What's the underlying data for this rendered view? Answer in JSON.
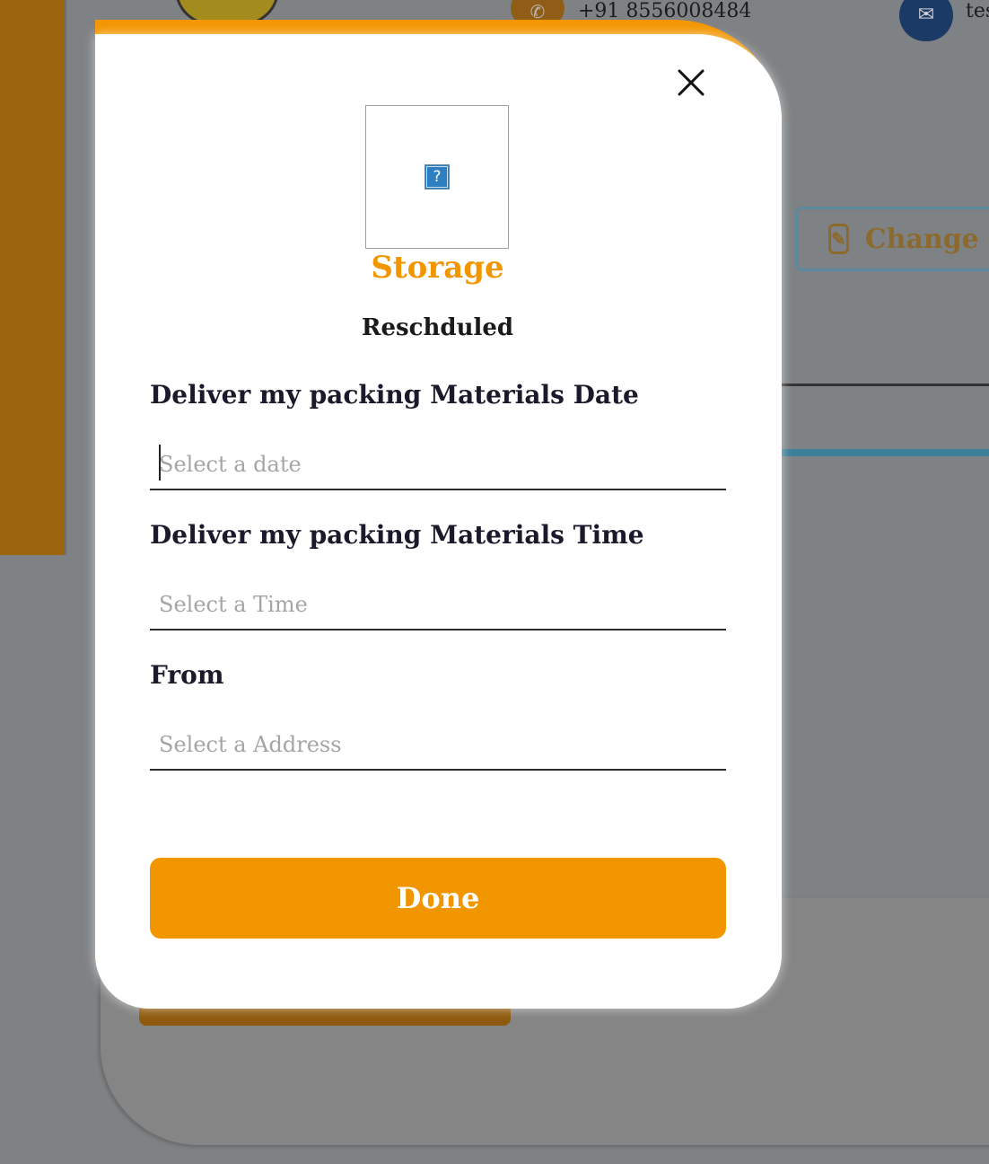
{
  "background": {
    "phone_number": "+91 8556008484",
    "email_text": "tes",
    "change_button_label": "Change Pa",
    "phone_icon": "phone-icon",
    "mail_icon": "mail-icon",
    "pencil_icon": "pencil-icon"
  },
  "modal": {
    "close_icon": "close-icon",
    "image_icon": "broken-image-icon",
    "broken_image_glyph": "?",
    "title": "Storage",
    "subtitle": "Reschduled",
    "fields": [
      {
        "label": "Deliver my packing Materials Date",
        "placeholder": "Select a date",
        "value": ""
      },
      {
        "label": "Deliver my packing Materials Time",
        "placeholder": "Select a Time",
        "value": ""
      },
      {
        "label": "From",
        "placeholder": "Select a Address",
        "value": ""
      }
    ],
    "done_label": "Done"
  },
  "colors": {
    "accent": "#f29600",
    "text_dark": "#1a1a2a",
    "placeholder": "#a5a5a5",
    "overlay": "#8a8a8a"
  }
}
